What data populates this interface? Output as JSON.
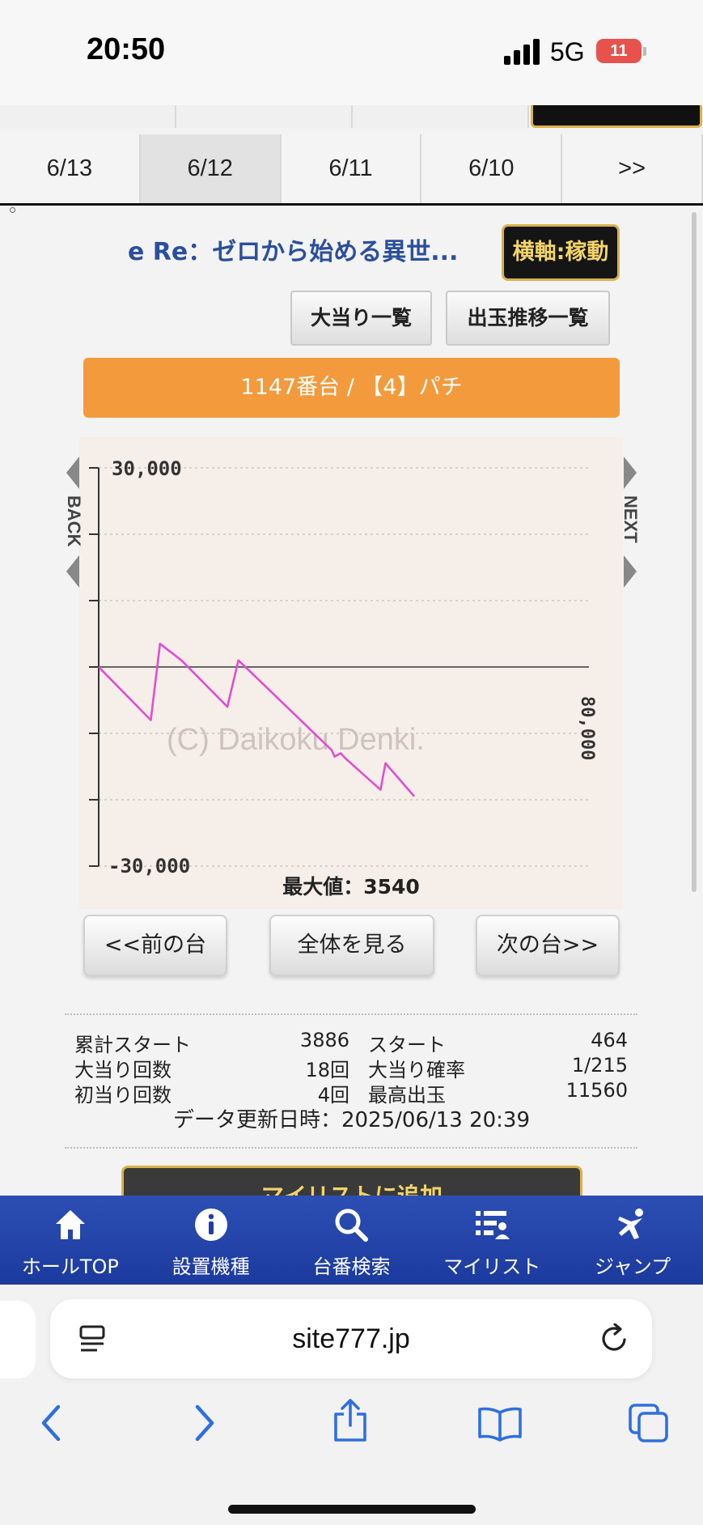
{
  "status_bar": {
    "time": "20:50",
    "network": "5G",
    "battery": "11"
  },
  "date_tabs": [
    {
      "label": "6/13",
      "active": false
    },
    {
      "label": "6/12",
      "active": true
    },
    {
      "label": "6/11",
      "active": false
    },
    {
      "label": "6/10",
      "active": false
    },
    {
      "label": ">>",
      "active": false
    }
  ],
  "header": {
    "machine_title": "e Re：ゼロから始める異世...",
    "axis_toggle_label": "横軸:稼動",
    "jackpot_list_label": "大当り一覧",
    "payout_trend_label": "出玉推移一覧",
    "unit_banner": "1147番台 / 【4】パチ"
  },
  "chart": {
    "back_label": "BACK",
    "next_label": "NEXT",
    "watermark": "(C) Daikoku Denki.",
    "max_value_label": "最大値：3540"
  },
  "chart_data": {
    "type": "line",
    "x_axis_right_label": "80,000",
    "ylim": [
      -30000,
      30000
    ],
    "xlim": [
      0,
      80000
    ],
    "y_tick_labels": [
      "30,000",
      "-30,000"
    ],
    "y_ticks": [
      30000,
      20000,
      10000,
      0,
      -10000,
      -20000,
      -30000
    ],
    "grid": true,
    "series": [
      {
        "color": "#e04ed0",
        "x": [
          0,
          8500,
          10000,
          13500,
          21000,
          21500,
          22800,
          24500,
          38000,
          38500,
          39500,
          40300,
          46000,
          46800,
          51500
        ],
        "y": [
          0,
          -8000,
          3500,
          1000,
          -6000,
          -4000,
          1000,
          -500,
          -12500,
          -13500,
          -13000,
          -13800,
          -18500,
          -14500,
          -19500
        ]
      }
    ]
  },
  "nav_buttons": {
    "prev": "<<前の台",
    "all": "全体を見る",
    "next": "次の台>>"
  },
  "stats": {
    "rows": [
      {
        "label1": "累計スタート",
        "value1": "3886",
        "label2": "スタート",
        "value2": "464"
      },
      {
        "label1": "大当り回数",
        "value1": "18回",
        "label2": "大当り確率",
        "value2": "1/215"
      },
      {
        "label1": "初当り回数",
        "value1": "4回",
        "label2": "最高出玉",
        "value2": "11560"
      }
    ],
    "updated": "データ更新日時：2025/06/13 20:39"
  },
  "mylist_button": "マイリストに追加",
  "site_nav": [
    {
      "label": "ホールTOP",
      "icon": "home-icon"
    },
    {
      "label": "設置機種",
      "icon": "info-icon"
    },
    {
      "label": "台番検索",
      "icon": "search-icon"
    },
    {
      "label": "マイリスト",
      "icon": "list-user-icon"
    },
    {
      "label": "ジャンプ",
      "icon": "jump-icon"
    }
  ],
  "browser": {
    "url": "site777.jp"
  },
  "colors": {
    "accent_blue": "#1c3a9e",
    "banner_orange": "#f39a3c",
    "series_magenta": "#e04ed0",
    "gold": "#d9b24a"
  }
}
